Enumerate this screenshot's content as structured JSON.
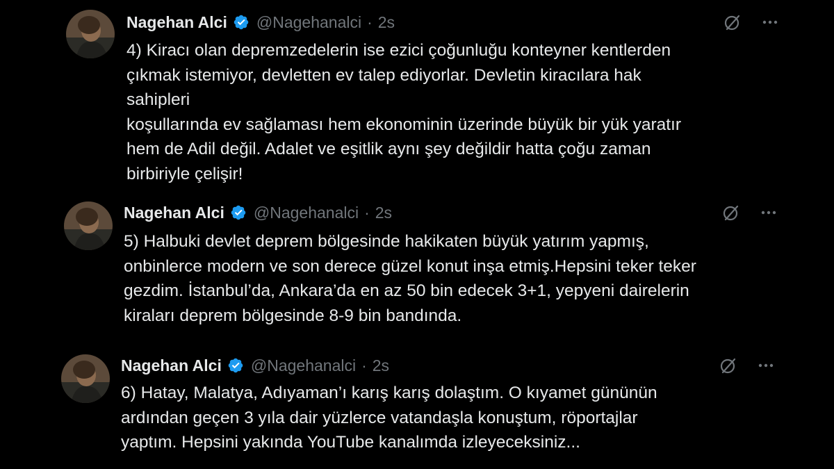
{
  "colors": {
    "background": "#000000",
    "text_primary": "#e7e9ea",
    "text_secondary": "#71767b",
    "verified_badge": "#1d9bf0"
  },
  "icons": {
    "verified": "verified-badge-icon",
    "grok": "grok-icon",
    "more": "more-options-icon"
  },
  "tweets": [
    {
      "author": {
        "name": "Nagehan Alci",
        "handle": "@Nagehanalci",
        "verified": true
      },
      "separator": "·",
      "time": "2s",
      "lines": [
        "4) Kiracı olan depremzedelerin ise ezici çoğunluğu konteyner kentlerden",
        "çıkmak istemiyor, devletten ev talep ediyorlar. Devletin kiracılara hak",
        "sahipleri",
        "koşullarında ev sağlaması hem ekonominin üzerinde büyük bir yük yaratır",
        "hem de Adil değil. Adalet ve eşitlik aynı şey değildir hatta çoğu zaman",
        "birbiriyle çelişir!"
      ]
    },
    {
      "author": {
        "name": "Nagehan Alci",
        "handle": "@Nagehanalci",
        "verified": true
      },
      "separator": "·",
      "time": "2s",
      "lines": [
        "5) Halbuki devlet deprem bölgesinde hakikaten büyük yatırım yapmış,",
        "onbinlerce modern ve son derece güzel konut inşa etmiş.Hepsini teker teker",
        "gezdim. İstanbul’da, Ankara’da en az 50 bin edecek 3+1, yepyeni dairelerin",
        "kiraları deprem bölgesinde 8-9 bin bandında."
      ]
    },
    {
      "author": {
        "name": "Nagehan Alci",
        "handle": "@Nagehanalci",
        "verified": true
      },
      "separator": "·",
      "time": "2s",
      "lines": [
        "6) Hatay, Malatya, Adıyaman’ı karış karış dolaştım. O kıyamet gününün",
        "ardından geçen 3 yıla dair yüzlerce vatandaşla konuştum, röportajlar",
        "yaptım. Hepsini yakında YouTube kanalımda izleyeceksiniz..."
      ]
    }
  ]
}
